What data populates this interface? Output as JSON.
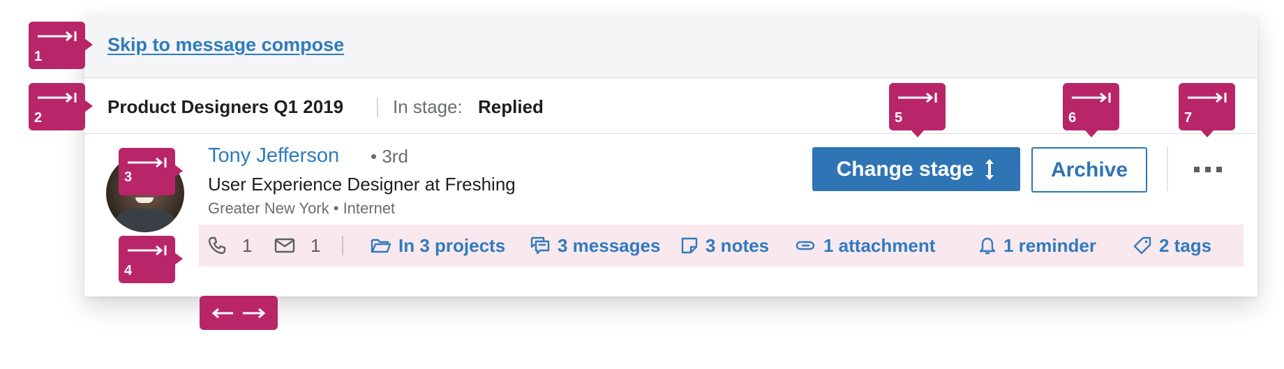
{
  "skip_link": "Skip to message compose",
  "stage_bar": {
    "project_name": "Product Designers Q1 2019",
    "stage_label": "In stage:",
    "stage_value": "Replied"
  },
  "candidate": {
    "name": "Tony Jefferson",
    "degree": "• 3rd",
    "headline": "User Experience Designer at Freshing",
    "location": "Greater New York • Internet"
  },
  "actions": {
    "change_stage": "Change stage",
    "archive": "Archive",
    "more_icon": "more-horizontal-icon"
  },
  "stats": {
    "calls": "1",
    "emails": "1",
    "projects": "In 3 projects",
    "messages": "3 messages",
    "notes": "3 notes",
    "attachments": "1 attachment",
    "reminders": "1 reminder",
    "tags": "2 tags"
  },
  "callouts": {
    "c1": "1",
    "c2": "2",
    "c3": "3",
    "c4": "4",
    "c5": "5",
    "c6": "6",
    "c7": "7"
  },
  "colors": {
    "brand_blue": "#2f74b4",
    "link_blue": "#2f7bbd",
    "callout_magenta": "#b82669",
    "stats_bg": "#f9e8ee"
  }
}
